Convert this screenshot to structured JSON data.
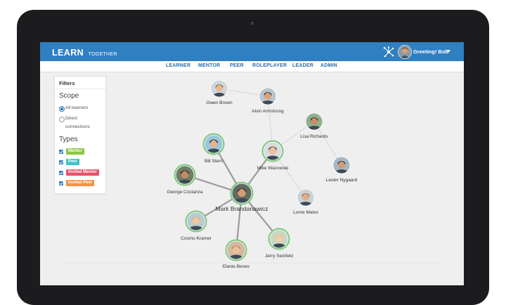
{
  "app": {
    "logo_main": "LEARN",
    "logo_sub": "TOGETHER",
    "greeting": "Greeting! Bob"
  },
  "nav": {
    "items": [
      "LEARNER",
      "MENTOR",
      "PEER",
      "ROLEPLAYER",
      "LEADER",
      "ADMIN"
    ]
  },
  "filters": {
    "title": "Filters",
    "scope_heading": "Scope",
    "scope_options": [
      {
        "label": "All learners",
        "selected": true
      },
      {
        "label": "Direct connections",
        "selected": false
      }
    ],
    "types_heading": "Types",
    "types": [
      {
        "label": "Mentor",
        "color": "#8cc63f",
        "checked": true
      },
      {
        "label": "Peer",
        "color": "#3fc1c9",
        "checked": true
      },
      {
        "label": "Invited Mentor",
        "color": "#e8506a",
        "checked": true
      },
      {
        "label": "Invited Peer",
        "color": "#f3934a",
        "checked": true
      }
    ]
  },
  "graph": {
    "colors": {
      "edge_strong": "#9a9a9a",
      "edge_dotted": "#b5b5b5",
      "ring": "#7ec77e",
      "label": "#333333"
    },
    "nodes": [
      {
        "id": "owen",
        "name": "Owen Brown",
        "ring": false,
        "skin": "#e6b995",
        "hair": "#8c5e32",
        "bg": "#cfd7dd"
      },
      {
        "id": "alvin",
        "name": "Alvin Armstrong",
        "ring": false,
        "skin": "#d9a27d",
        "hair": "#2b2b2b",
        "bg": "#b9c4cc"
      },
      {
        "id": "lisa",
        "name": "Lisa Richards",
        "ring": false,
        "skin": "#c98e66",
        "hair": "#3a2a1e",
        "bg": "#8fb08f"
      },
      {
        "id": "bill",
        "name": "Bill Stern",
        "ring": true,
        "skin": "#e3b28e",
        "hair": "#1e1e1e",
        "bg": "#9bc6df"
      },
      {
        "id": "mike",
        "name": "Mike Wazowski",
        "ring": true,
        "skin": "#e8c0a0",
        "hair": "#5a3b22",
        "bg": "#d8dde0"
      },
      {
        "id": "lester",
        "name": "Lester Nygaard",
        "ring": false,
        "skin": "#d39c77",
        "hair": "#2a2a2a",
        "bg": "#a7b6c2"
      },
      {
        "id": "george",
        "name": "George Costanza",
        "ring": true,
        "skin": "#c38a63",
        "hair": "#2b1d15",
        "bg": "#6e7d66"
      },
      {
        "id": "mark",
        "name": "Mark Brandanawicz",
        "ring": true,
        "skin": "#d79b72",
        "hair": "#3b2a1c",
        "bg": "#5f6b63"
      },
      {
        "id": "lorne",
        "name": "Lorne Malvo",
        "ring": false,
        "skin": "#e1ad86",
        "hair": "#a7673a",
        "bg": "#c9d2d8"
      },
      {
        "id": "cosmo",
        "name": "Cosmo Kramer",
        "ring": true,
        "skin": "#efc7a5",
        "hair": "#d9b36a",
        "bg": "#b7cbd6"
      },
      {
        "id": "jerry",
        "name": "Jerry Seinfeld",
        "ring": true,
        "skin": "#f0ccab",
        "hair": "#e1c27e",
        "bg": "#c8d8c6"
      },
      {
        "id": "elanie",
        "name": "Elanie Benes",
        "ring": true,
        "skin": "#eac09c",
        "hair": "#c07a3a",
        "bg": "#d3b9a3"
      }
    ],
    "edges": [
      {
        "a": "mark",
        "b": "bill",
        "style": "strong"
      },
      {
        "a": "mark",
        "b": "mike",
        "style": "strong"
      },
      {
        "a": "mark",
        "b": "george",
        "style": "strong"
      },
      {
        "a": "mark",
        "b": "cosmo",
        "style": "strong"
      },
      {
        "a": "mark",
        "b": "elanie",
        "style": "strong"
      },
      {
        "a": "mark",
        "b": "jerry",
        "style": "strong"
      },
      {
        "a": "owen",
        "b": "alvin",
        "style": "dotted"
      },
      {
        "a": "alvin",
        "b": "mike",
        "style": "dotted"
      },
      {
        "a": "mike",
        "b": "lisa",
        "style": "dotted"
      },
      {
        "a": "lisa",
        "b": "lester",
        "style": "dotted"
      },
      {
        "a": "mike",
        "b": "lorne",
        "style": "dotted"
      }
    ]
  }
}
